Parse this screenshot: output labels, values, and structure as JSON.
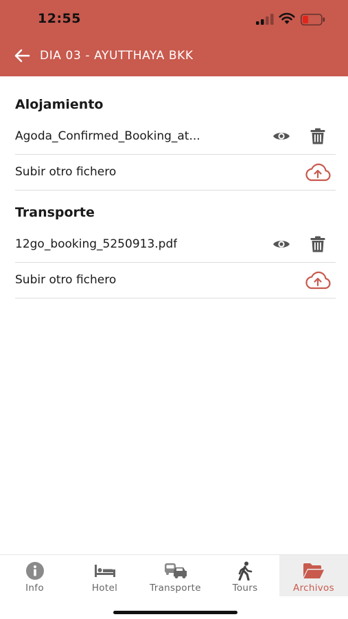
{
  "status_bar": {
    "time": "12:55"
  },
  "header": {
    "title": "DIA 03 - AYUTTHAYA BKK",
    "color": "#c85a4e"
  },
  "sections": [
    {
      "title": "Alojamiento",
      "file_name": "Agoda_Confirmed_Booking_at...",
      "upload_label": "Subir otro fichero"
    },
    {
      "title": "Transporte",
      "file_name": "12go_booking_5250913.pdf",
      "upload_label": "Subir otro fichero"
    }
  ],
  "tabs": [
    {
      "label": "Info",
      "icon": "info-icon"
    },
    {
      "label": "Hotel",
      "icon": "bed-icon"
    },
    {
      "label": "Transporte",
      "icon": "vehicles-icon"
    },
    {
      "label": "Tours",
      "icon": "walking-icon"
    },
    {
      "label": "Archivos",
      "icon": "folder-open-icon",
      "active": true
    }
  ],
  "colors": {
    "accent": "#c85a4e",
    "icon_gray": "#555555"
  }
}
